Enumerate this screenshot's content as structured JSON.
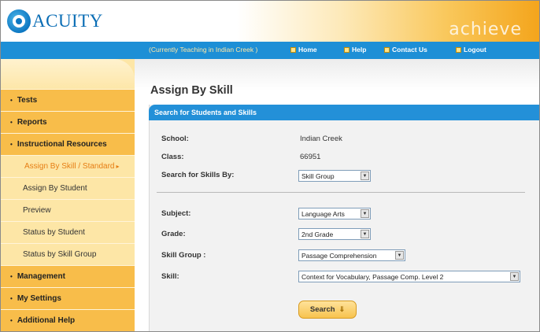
{
  "header": {
    "logo_text": "ACUITY",
    "watermark": "achieve"
  },
  "navbar": {
    "teacher_status": "(Currently Teaching in Indian Creek )",
    "links": [
      {
        "label": "Home",
        "icon": "home-icon"
      },
      {
        "label": "Help",
        "icon": "help-icon"
      },
      {
        "label": "Contact Us",
        "icon": "contact-icon"
      },
      {
        "label": "Logout",
        "icon": "logout-icon"
      }
    ]
  },
  "sidebar": {
    "items": [
      {
        "label": "Tests",
        "type": "main"
      },
      {
        "label": "Reports",
        "type": "main"
      },
      {
        "label": "Instructional Resources",
        "type": "main"
      },
      {
        "label": "Assign By Skill / Standard",
        "type": "sub",
        "active": true
      },
      {
        "label": "Assign By Student",
        "type": "sub"
      },
      {
        "label": "Preview",
        "type": "sub"
      },
      {
        "label": "Status by Student",
        "type": "sub"
      },
      {
        "label": "Status by Skill Group",
        "type": "sub"
      },
      {
        "label": "Management",
        "type": "main"
      },
      {
        "label": "My Settings",
        "type": "main"
      },
      {
        "label": "Additional Help",
        "type": "main"
      }
    ]
  },
  "main": {
    "page_title": "Assign By Skill",
    "panel_title": "Search for Students and Skills",
    "fields": {
      "school": {
        "label": "School:",
        "value": "Indian Creek"
      },
      "class": {
        "label": "Class:",
        "value": "66951"
      },
      "search_by": {
        "label": "Search for Skills By:",
        "value": "Skill Group"
      },
      "subject": {
        "label": "Subject:",
        "value": "Language Arts"
      },
      "grade": {
        "label": "Grade:",
        "value": "2nd Grade"
      },
      "skill_group": {
        "label": "Skill Group :",
        "value": "Passage Comprehension"
      },
      "skill": {
        "label": "Skill:",
        "value": "Context for Vocabulary, Passage Comp. Level 2"
      }
    },
    "search_button": "Search"
  },
  "colors": {
    "nav_blue": "#1d8fd6",
    "sidebar_orange": "#f8bd4a",
    "sidebar_light": "#fde6a6",
    "active_link": "#e67e14"
  }
}
